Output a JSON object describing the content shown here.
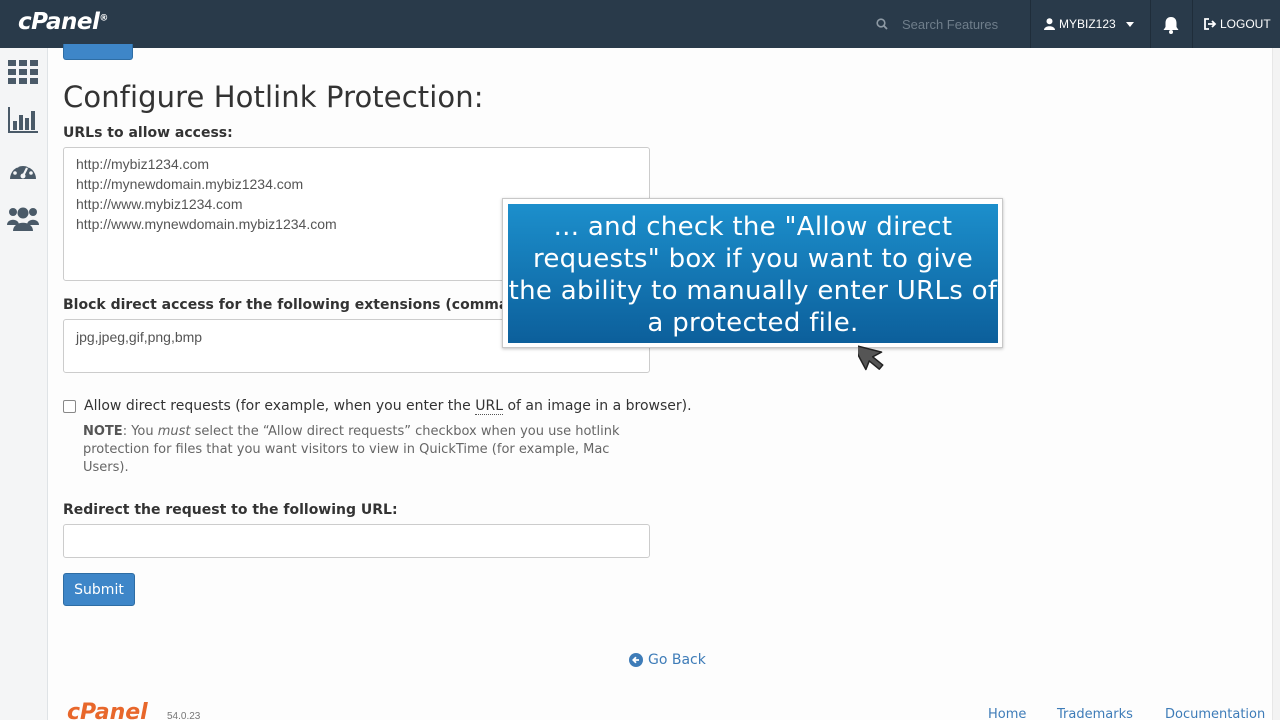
{
  "header": {
    "logo_text": "cPanel",
    "logo_mark": "®",
    "search_placeholder": "Search Features",
    "username": "MYBIZ123",
    "logout_label": "LOGOUT",
    "icons": [
      "search-icon",
      "user-icon",
      "chevron-down-icon",
      "bell-icon",
      "logout-icon"
    ]
  },
  "sidebar": {
    "items": [
      {
        "name": "home",
        "icon": "grid-icon"
      },
      {
        "name": "statistics",
        "icon": "bar-chart-icon"
      },
      {
        "name": "dashboard",
        "icon": "speedometer-icon"
      },
      {
        "name": "users",
        "icon": "users-icon"
      }
    ]
  },
  "main": {
    "title": "Configure Hotlink Protection:",
    "urls_label": "URLs to allow access:",
    "urls_value": "http://mybiz1234.com\nhttp://mynewdomain.mybiz1234.com\nhttp://www.mybiz1234.com\nhttp://www.mynewdomain.mybiz1234.com",
    "extensions_label": "Block direct access for the following extensions (comma-separa",
    "extensions_value": "jpg,jpeg,gif,png,bmp",
    "allow_direct": {
      "checked": false,
      "label_before": "Allow direct requests (for example, when you enter the ",
      "label_abbr": "URL",
      "label_after": " of an image in a browser)."
    },
    "note": {
      "prefix": "NOTE",
      "text_1": ": You ",
      "emphasis": "must",
      "text_2": " select the “Allow direct requests” checkbox when you use hotlink protection for files that you want visitors to view in QuickTime (for example, Mac Users)."
    },
    "redirect_label": "Redirect the request to the following URL:",
    "redirect_value": "",
    "submit_label": "Submit",
    "go_back_label": "Go Back"
  },
  "footer": {
    "logo_text": "cPanel",
    "version": "54.0.23",
    "links": [
      "Home",
      "Trademarks",
      "Documentation"
    ]
  },
  "tutorial": {
    "callout_text": "... and check the \"Allow direct requests\" box if you want to give the ability to manually enter URLs of a protected file."
  },
  "colors": {
    "topbar": "#293a4a",
    "primary_button": "#3e86c8",
    "link": "#3e7cb8",
    "callout_top": "#1c8fcc",
    "callout_bottom": "#0c5f9b",
    "footer_logo": "#e8672b"
  }
}
